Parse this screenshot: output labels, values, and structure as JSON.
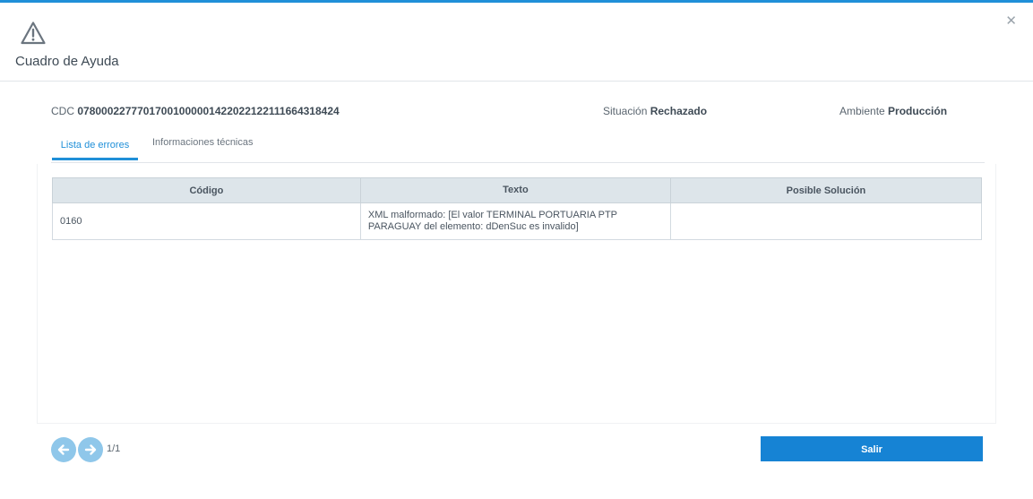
{
  "dialog": {
    "title": "Cuadro de Ayuda",
    "close_symbol": "✕",
    "icons": {
      "header": "warning-triangle-icon",
      "close": "close-icon",
      "prev": "arrow-left-icon",
      "next": "arrow-right-icon"
    },
    "accent_color": "#1f8fd8"
  },
  "info": {
    "cdc_label": "CDC",
    "cdc_value": "07800022777017001000001422022122111664318424",
    "situacion_label": "Situación",
    "situacion_value": "Rechazado",
    "ambiente_label": "Ambiente",
    "ambiente_value": "Producción"
  },
  "tabs": [
    {
      "label": "Lista de errores",
      "active": true
    },
    {
      "label": "Informaciones técnicas",
      "active": false
    }
  ],
  "table": {
    "headers": [
      "Código",
      "Texto",
      "Posible Solución"
    ],
    "rows": [
      {
        "codigo": "0160",
        "texto": "XML malformado: [El valor TERMINAL PORTUARIA PTP PARAGUAY del elemento: dDenSuc es invalido]",
        "solucion": ""
      }
    ]
  },
  "pagination": {
    "page_label": "1/1"
  },
  "footer": {
    "salir_label": "Salir"
  }
}
